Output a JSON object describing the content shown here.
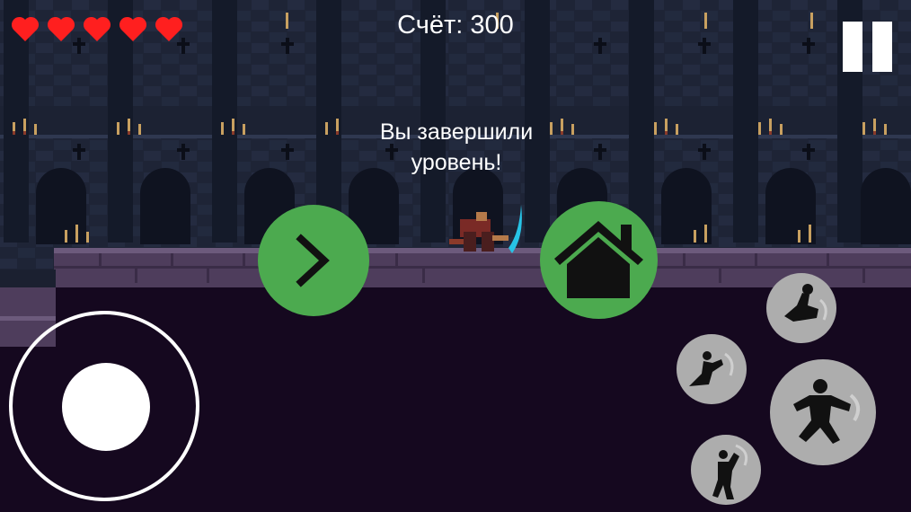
{
  "hud": {
    "lives_total": 5,
    "lives_remaining": 5,
    "score_text": "Счёт: 300"
  },
  "dialog": {
    "message_line1": "Вы завершили",
    "message_line2": "уровень!"
  },
  "icons": {
    "heart": "heart-icon",
    "pause": "pause-icon",
    "next": "chevron-right-icon",
    "home": "home-icon"
  },
  "colors": {
    "heart": "#ff1f1f",
    "button_green": "#4caa4f",
    "skill_button": "#adadad"
  }
}
